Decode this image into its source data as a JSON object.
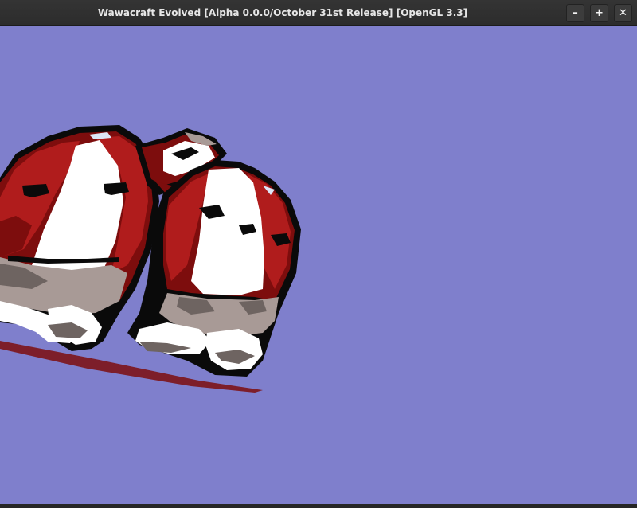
{
  "window": {
    "title": "Wawacraft Evolved [Alpha 0.0.0/October 31st Release] [OpenGL 3.3]",
    "buttons": {
      "minimize_glyph": "–",
      "maximize_glyph": "+",
      "close_glyph": "✕"
    }
  },
  "scene": {
    "sky_color": "#7f7fcc",
    "entity": "creature-model",
    "palette": {
      "red": "#b01c1c",
      "dark_red": "#7d0d0d",
      "white": "#ffffff",
      "gray": "#a89a96",
      "dark_gray": "#6e6461",
      "black": "#0a0a0a"
    }
  }
}
